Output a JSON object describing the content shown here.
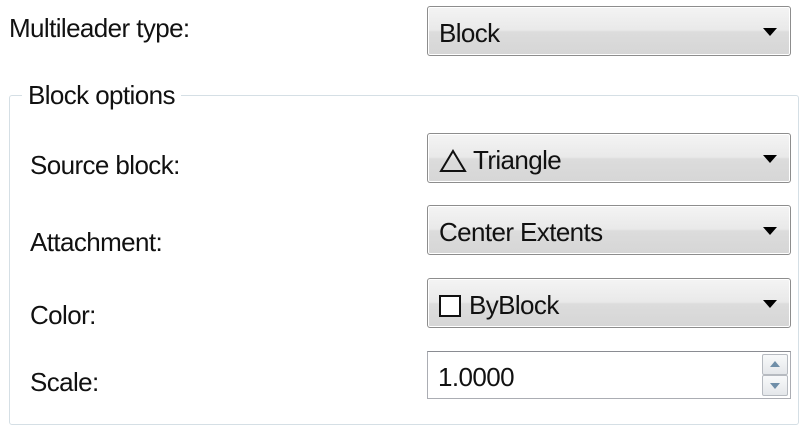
{
  "multileader_type": {
    "label": "Multileader type:",
    "value": "Block"
  },
  "block_options": {
    "title": "Block options",
    "source_block": {
      "label": "Source block:",
      "value": "Triangle",
      "icon": "triangle-outline-icon"
    },
    "attachment": {
      "label": "Attachment:",
      "value": "Center Extents"
    },
    "color": {
      "label": "Color:",
      "value": "ByBlock",
      "swatch_color": "#ffffff"
    },
    "scale": {
      "label": "Scale:",
      "value": "1.0000"
    }
  }
}
